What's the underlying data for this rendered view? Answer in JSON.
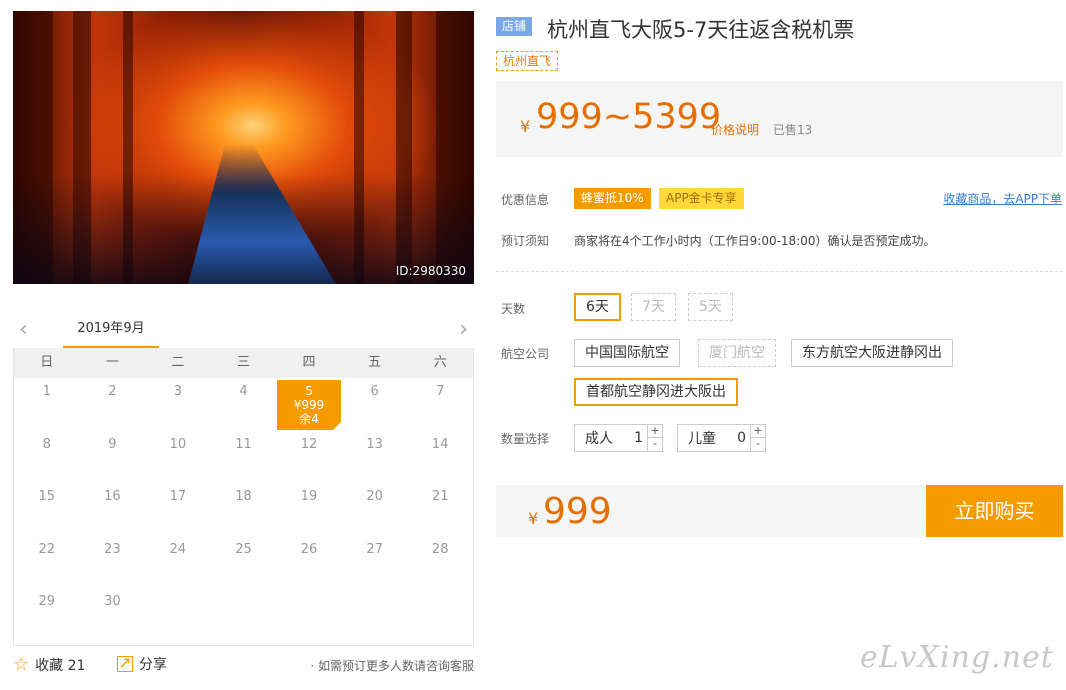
{
  "hero": {
    "id_label": "ID:2980330"
  },
  "calendar": {
    "month": "2019年9月",
    "weekdays": [
      "日",
      "一",
      "二",
      "三",
      "四",
      "五",
      "六"
    ],
    "days": [
      "1",
      "2",
      "3",
      "4",
      "5",
      "6",
      "7",
      "8",
      "9",
      "10",
      "11",
      "12",
      "13",
      "14",
      "15",
      "16",
      "17",
      "18",
      "19",
      "20",
      "21",
      "22",
      "23",
      "24",
      "25",
      "26",
      "27",
      "28",
      "29",
      "30"
    ],
    "active_day": {
      "day": "5",
      "price": "¥999",
      "remaining": "余4"
    }
  },
  "footer": {
    "favorite_label": "收藏 21",
    "share_label": "分享",
    "consult_text": "· 如需预订更多人数请咨询客服"
  },
  "product": {
    "store_badge": "店铺",
    "title": "杭州直飞大阪5-7天往返含税机票",
    "tag": "杭州直飞",
    "price_yen": "¥",
    "price_range": "999~5399",
    "price_explain": "价格说明",
    "sold": "已售13"
  },
  "promo": {
    "label": "优惠信息",
    "discount": "蜂蜜抵10%",
    "app_card": "APP金卡专享",
    "fav_app_link": "收藏商品，去APP下单"
  },
  "booking": {
    "label": "预订须知",
    "notice": "商家将在4个工作小时内（工作日9:00-18:00）确认是否预定成功。"
  },
  "days_option": {
    "label": "天数",
    "options": [
      "6天",
      "7天",
      "5天"
    ]
  },
  "airline_option": {
    "label": "航空公司",
    "options": [
      "中国国际航空",
      "厦门航空",
      "东方航空大阪进静冈出",
      "首都航空静冈进大阪出"
    ]
  },
  "quantity": {
    "label": "数量选择",
    "adult_label": "成人",
    "adult_value": "1",
    "child_label": "儿童",
    "child_value": "0",
    "plus": "+",
    "minus": "-"
  },
  "buy": {
    "yen": "¥",
    "price": "999",
    "button": "立即购买"
  },
  "watermark": "eLvXing.net",
  "icons": {
    "prev": "chevron-left-icon",
    "next": "chevron-right-icon",
    "star": "star-icon",
    "share": "share-icon"
  },
  "colors": {
    "accent": "#f49b00",
    "price": "#e66e00",
    "link": "#3a7bd5",
    "store_badge": "#7aa7e8"
  }
}
